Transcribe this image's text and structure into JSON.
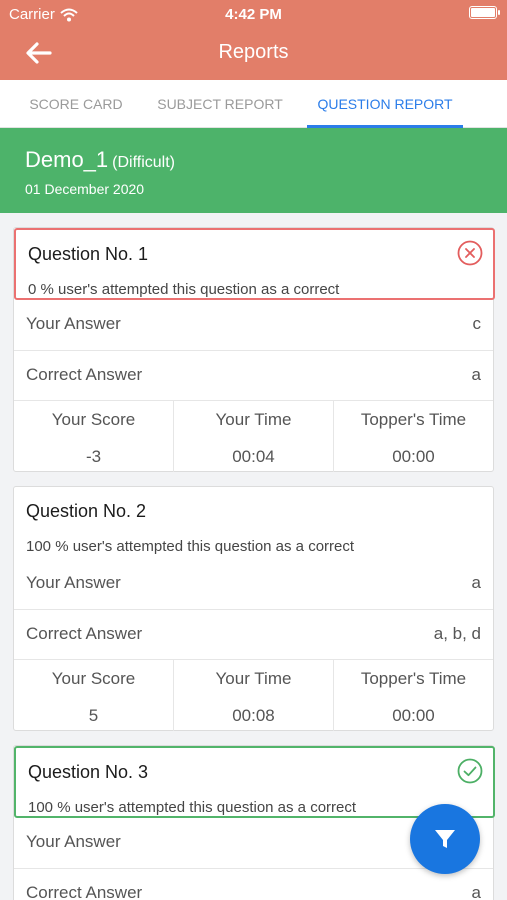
{
  "status_bar": {
    "carrier": "Carrier",
    "time": "4:42 PM",
    "wifi_icon": "wifi-icon",
    "battery_icon": "battery-icon"
  },
  "nav": {
    "title": "Reports",
    "back_icon": "back-arrow-icon"
  },
  "tabs": [
    {
      "label": "SCORE CARD",
      "active": false
    },
    {
      "label": "SUBJECT REPORT",
      "active": false
    },
    {
      "label": "QUESTION REPORT",
      "active": true
    }
  ],
  "test": {
    "name": "Demo_1",
    "level": "(Difficult)",
    "date": "01 December 2020"
  },
  "labels": {
    "your_answer": "Your Answer",
    "correct_answer": "Correct Answer",
    "your_score": "Your Score",
    "your_time": "Your Time",
    "toppers_time": "Topper's Time"
  },
  "questions": [
    {
      "title": "Question No. 1",
      "attempt_text": "0 % user's attempted this question as a correct",
      "result": "incorrect",
      "result_icon": "close-circle-icon",
      "your_answer": "c",
      "correct_answer": "a",
      "your_score": "-3",
      "your_time": "00:04",
      "toppers_time": "00:00"
    },
    {
      "title": "Question No. 2",
      "attempt_text": "100 % user's attempted this question as a correct",
      "result": "unmarked",
      "your_answer": "a",
      "correct_answer": "a, b, d",
      "your_score": "5",
      "your_time": "00:08",
      "toppers_time": "00:00"
    },
    {
      "title": "Question No. 3",
      "attempt_text": "100 % user's attempted this question as a correct",
      "result": "correct",
      "result_icon": "check-circle-icon",
      "correct_answer": "a"
    }
  ],
  "fab": {
    "icon": "filter-icon"
  },
  "colors": {
    "header": "#e27e69",
    "tab_active": "#2b7de9",
    "test_bar": "#4db36a",
    "incorrect": "#eb7171",
    "correct": "#52b46a",
    "fab": "#1976e0"
  }
}
